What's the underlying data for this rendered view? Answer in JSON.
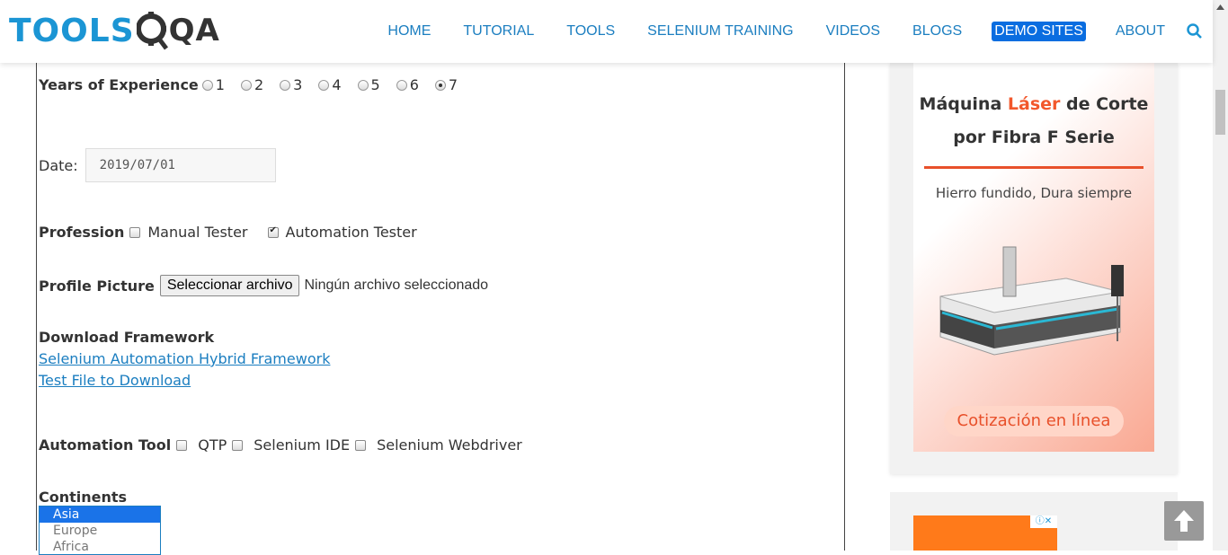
{
  "header": {
    "logo_tools": "TOOLS",
    "logo_qa": "QA",
    "nav": [
      "HOME",
      "TUTORIAL",
      "TOOLS",
      "SELENIUM TRAINING",
      "VIDEOS",
      "BLOGS",
      "DEMO SITES",
      "ABOUT"
    ],
    "active_nav": "DEMO SITES"
  },
  "form": {
    "experience_label": "Years of Experience",
    "experience_options": [
      "1",
      "2",
      "3",
      "4",
      "5",
      "6",
      "7"
    ],
    "experience_selected": "7",
    "date_label": "Date:",
    "date_value": "2019/07/01",
    "profession_label": "Profession",
    "profession_opt1": "Manual Tester",
    "profession_opt2": "Automation Tester",
    "profile_label": "Profile Picture",
    "file_button": "Seleccionar archivo",
    "file_status": "Ningún archivo seleccionado",
    "download_label": "Download Framework",
    "link1": "Selenium Automation Hybrid Framework",
    "link2": "Test File to Download",
    "tool_label": "Automation Tool",
    "tool_opt1": "QTP",
    "tool_opt2": "Selenium IDE",
    "tool_opt3": "Selenium Webdriver",
    "continents_label": "Continents",
    "continents": [
      "Asia",
      "Europe",
      "Africa"
    ]
  },
  "ad": {
    "title_pre": "Máquina ",
    "title_hl": "Láser",
    "title_post": " de Corte",
    "title_line2": "por Fibra F Serie",
    "subtitle": "Hierro fundido, Dura siempre",
    "cta": "Cotización en línea"
  },
  "colors": {
    "accent": "#1b7ec0",
    "active_nav_bg": "#0a6de0",
    "ad_orange": "#e8502a"
  }
}
